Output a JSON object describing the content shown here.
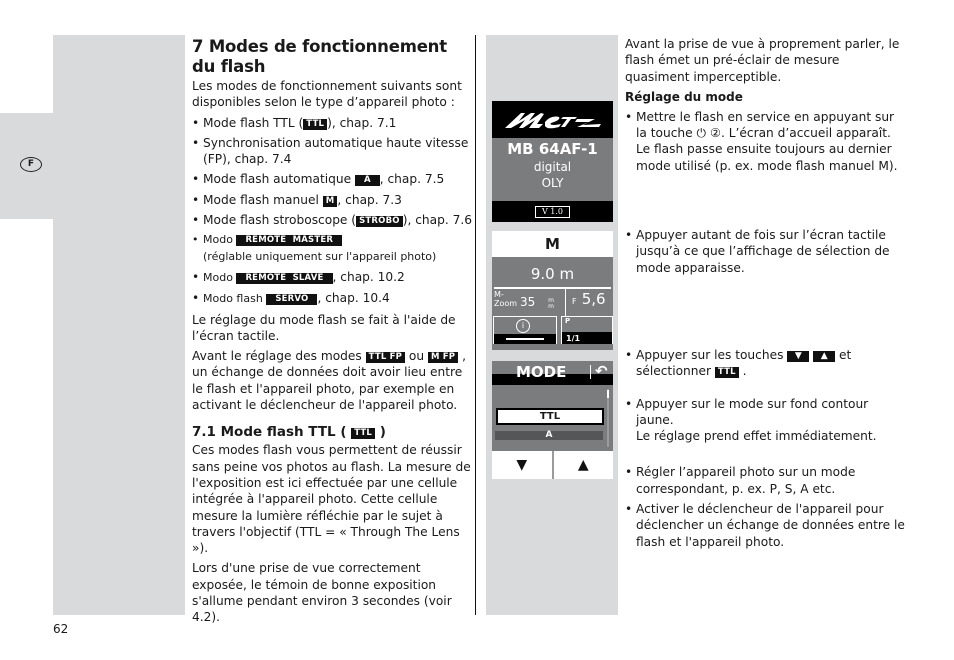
{
  "sidebar": {
    "language_badge": "F"
  },
  "page_number": "62",
  "left_column": {
    "title": "7 Modes de fonctionnement du flash",
    "intro": "Les modes de fonctionnement suivants sont disponibles selon le type d’appareil photo :",
    "modes": [
      {
        "before": "Mode flash TTL (",
        "tag": "TTL",
        "after": "), chap. 7.1"
      },
      {
        "before": "Synchronisation automatique haute vitesse (FP), chap. 7.4",
        "tag": "",
        "after": ""
      },
      {
        "before": "Mode flash automatique ",
        "tag": "A",
        "after": ", chap. 7.5"
      },
      {
        "before": "Mode flash manuel ",
        "tag": "M",
        "after": ", chap. 7.3"
      },
      {
        "before": "Mode flash stroboscope (",
        "tag": "STROBO",
        "after": "), chap. 7.6"
      },
      {
        "before": "Modo ",
        "tag": "REMOTE  MASTER",
        "after": "",
        "note": "(réglable uniquement sur l'appareil photo)"
      },
      {
        "before": "Modo ",
        "tag": "REMOTE  SLAVE",
        "after": ", chap. 10.2"
      },
      {
        "before": "Modo flash ",
        "tag": "SERVO",
        "after": ", chap. 10.4"
      }
    ],
    "para_touch": "Le réglage du mode flash se fait à l'aide de l’écran tactile.",
    "para_fp": {
      "before": "Avant le réglage des modes ",
      "tag1": "TTL FP",
      "mid": " ou ",
      "tag2": "M FP",
      "after": " , un échange de données doit avoir lieu entre le flash et l'appareil photo, par exemple en activant le déclencheur de l'appareil photo."
    },
    "section_title": {
      "before": "7.1 Mode flash TTL ( ",
      "tag": "TTL",
      "after": " )"
    },
    "para_ttl": "Ces modes flash vous permettent de réussir sans peine vos photos au flash. La mesure de l'exposition est ici effectuée par une cellule intégrée à l'appareil photo. Cette cellule mesure la lumière réfléchie par le sujet à travers l'objectif (TTL = « Through The Lens »).",
    "para_expo": "Lors d'une prise de vue correctement exposée, le témoin de bonne exposition s'allume pendant environ 3 secondes (voir 4.2)."
  },
  "screens": {
    "welcome": {
      "brand": "Metz",
      "model": "MB 64AF-1",
      "line1": "digital",
      "line2": "OLY",
      "version": "V 1.0"
    },
    "main": {
      "mode": "M",
      "distance": "9.0 m",
      "zoom_label_1": "M-",
      "zoom_label_2": "Zoom",
      "zoom_value": "35",
      "zoom_unit": "m m",
      "aperture_label": "F",
      "aperture_value": "5,6",
      "info_icon": "i",
      "page_label": "P",
      "page_value": "1/1"
    },
    "mode_select": {
      "title": "MODE",
      "back_icon": "↶",
      "selected": "TTL",
      "next": "A",
      "down": "▼",
      "up": "▲"
    }
  },
  "right_column": {
    "intro": "Avant la prise de vue à proprement parler, le flash émet un pré-éclair de mesure quasiment imperceptible.",
    "subtitle": "Réglage du mode",
    "step1": {
      "before": "Mettre le flash en service en appuyant sur la touche ",
      "power_icon": "⏻",
      "key": "②",
      "after": ". L’écran d’accueil apparaît. Le flash passe ensuite toujours au dernier mode utilisé (p. ex. mode flash manuel M)."
    },
    "step2": "Appuyer autant de fois sur l’écran tactile jusqu’à ce que l’affichage de sélection de mode apparaisse.",
    "step3": {
      "before": "Appuyer sur les touches ",
      "down": "▼",
      "up": "▲",
      "mid": " et sélectionner ",
      "tag": "TTL",
      "after": " ."
    },
    "step4a": "Appuyer sur le mode sur fond contour jaune.",
    "step4b": "Le réglage prend effet immédiatement.",
    "step5": "Régler l’appareil photo sur un mode correspondant, p. ex. P, S, A etc.",
    "step6": "Activer le déclencheur de l'appareil pour déclencher un échange de données entre le flash et l'appareil photo."
  }
}
